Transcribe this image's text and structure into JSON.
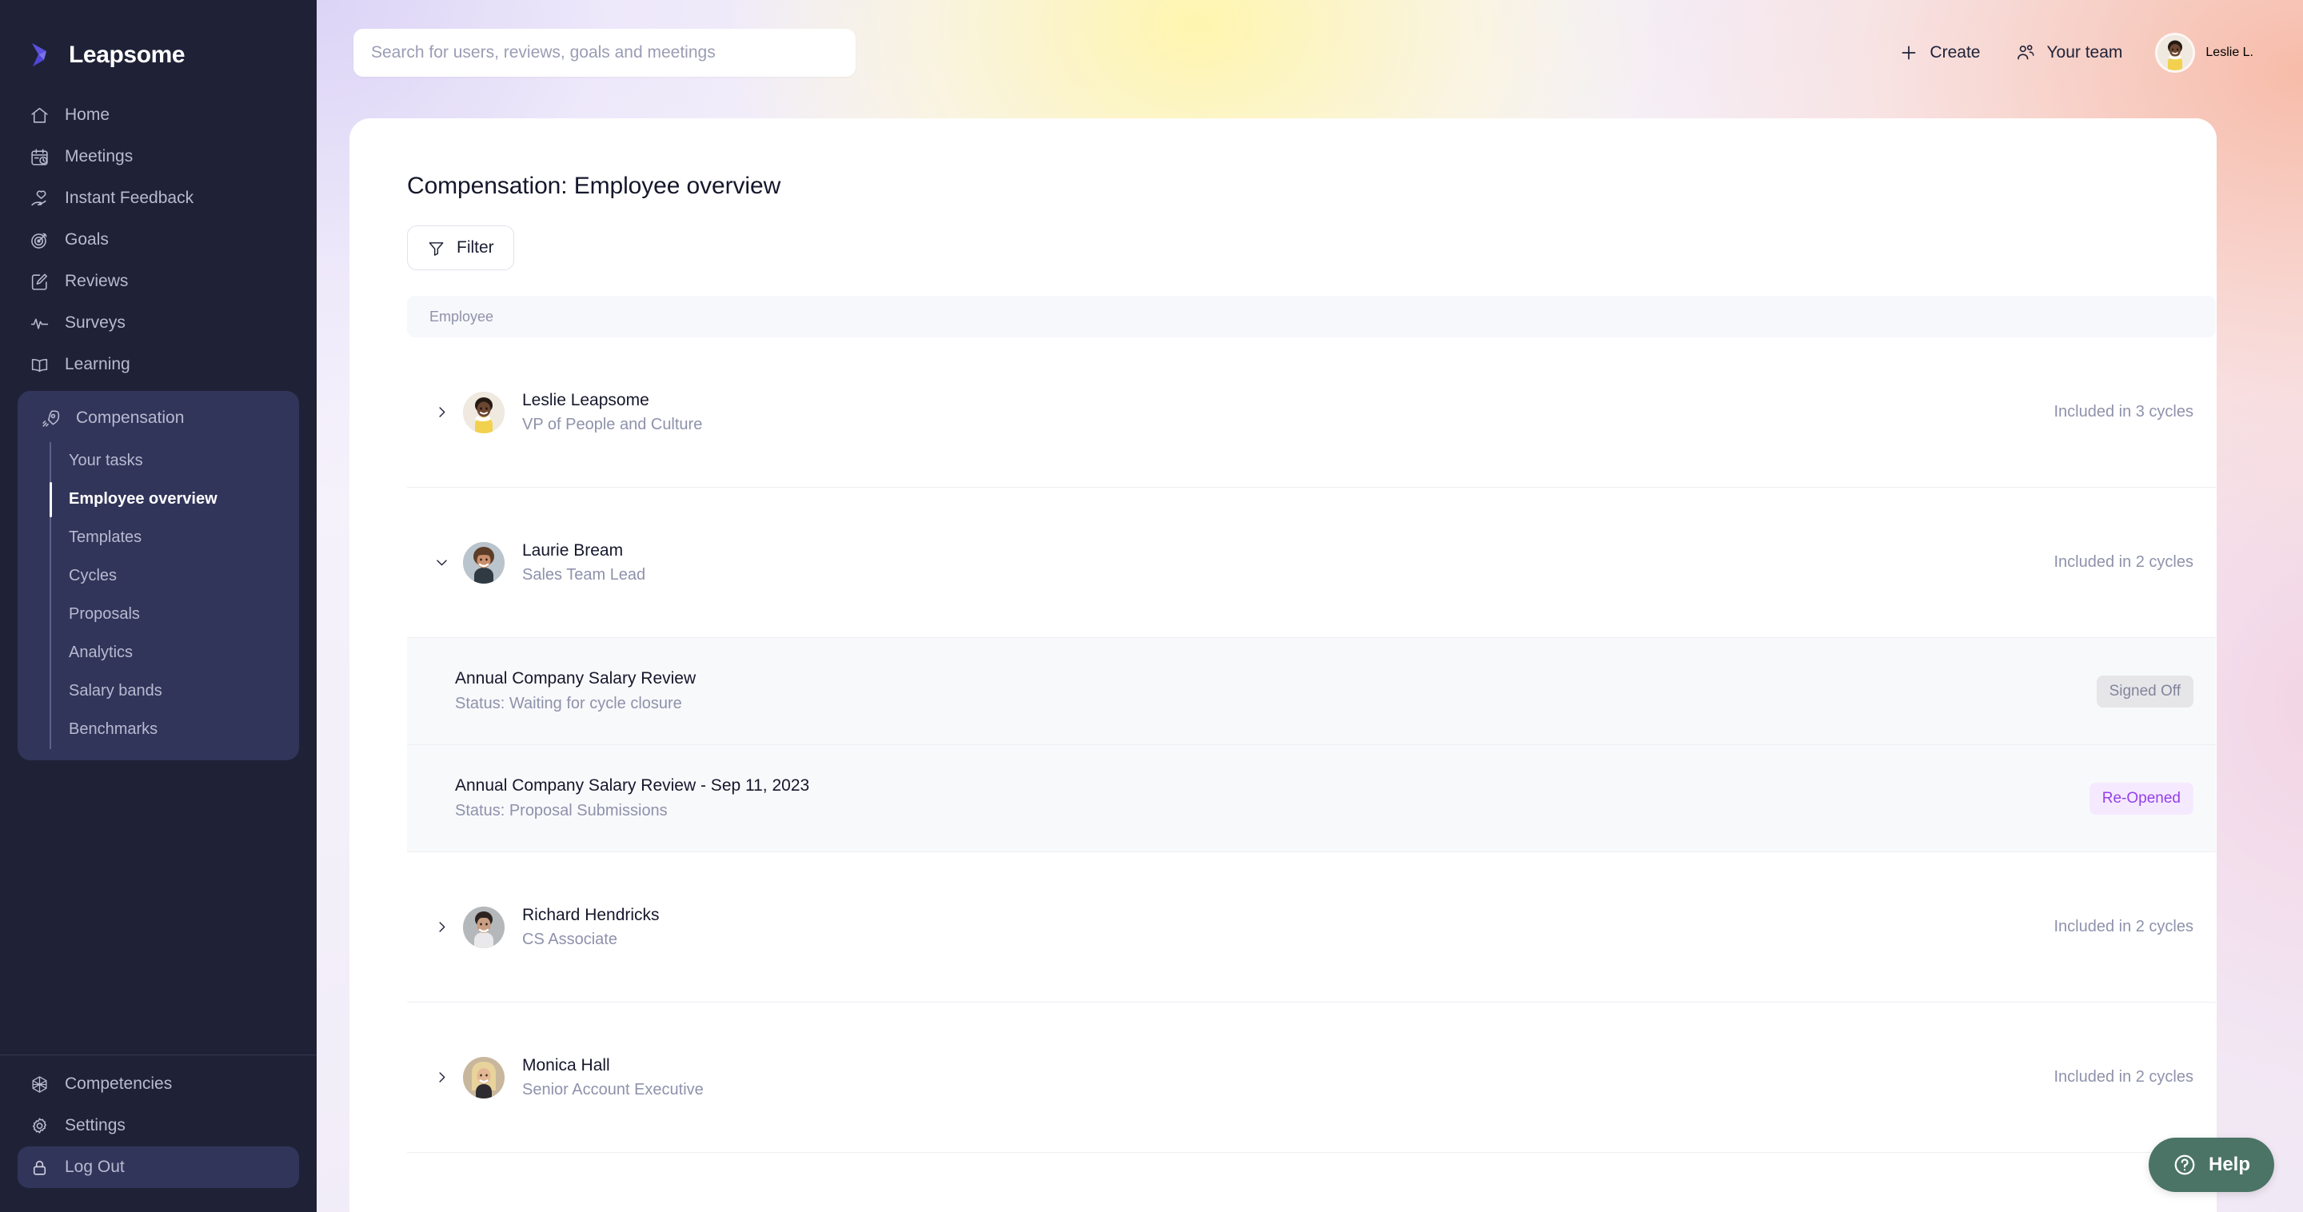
{
  "brand": {
    "name": "Leapsome"
  },
  "search": {
    "placeholder": "Search for users, reviews, goals and meetings",
    "value": ""
  },
  "topbar": {
    "create_label": "Create",
    "team_label": "Your team",
    "user_label": "Leslie L."
  },
  "sidebar": {
    "items": [
      {
        "label": "Home",
        "icon": "home-icon"
      },
      {
        "label": "Meetings",
        "icon": "calendar-clock-icon"
      },
      {
        "label": "Instant Feedback",
        "icon": "heart-hand-icon"
      },
      {
        "label": "Goals",
        "icon": "target-icon"
      },
      {
        "label": "Reviews",
        "icon": "pencil-square-icon"
      },
      {
        "label": "Surveys",
        "icon": "pulse-icon"
      },
      {
        "label": "Learning",
        "icon": "book-icon"
      }
    ],
    "group": {
      "label": "Compensation",
      "icon": "rocket-icon",
      "sub_items": [
        {
          "label": "Your tasks",
          "active": false
        },
        {
          "label": "Employee overview",
          "active": true
        },
        {
          "label": "Templates",
          "active": false
        },
        {
          "label": "Cycles",
          "active": false
        },
        {
          "label": "Proposals",
          "active": false
        },
        {
          "label": "Analytics",
          "active": false
        },
        {
          "label": "Salary bands",
          "active": false
        },
        {
          "label": "Benchmarks",
          "active": false
        }
      ]
    },
    "bottom_items": [
      {
        "label": "Competencies",
        "icon": "competency-icon"
      },
      {
        "label": "Settings",
        "icon": "gear-icon"
      },
      {
        "label": "Log Out",
        "icon": "lock-icon"
      }
    ]
  },
  "main": {
    "page_title": "Compensation: Employee overview",
    "filter_label": "Filter",
    "table": {
      "column_header": "Employee",
      "rows": [
        {
          "name": "Leslie Leapsome",
          "role": "VP of People and Culture",
          "meta": "Included in 3 cycles",
          "expanded": false,
          "avatar": "leslie",
          "cycles": []
        },
        {
          "name": "Laurie Bream",
          "role": "Sales Team Lead",
          "meta": "Included in 2 cycles",
          "expanded": true,
          "avatar": "laurie",
          "cycles": [
            {
              "title": "Annual Company Salary Review",
              "status": "Status: Waiting for cycle closure",
              "badge": "Signed Off",
              "badge_style": "grey"
            },
            {
              "title": "Annual Company Salary Review - Sep 11, 2023",
              "status": "Status: Proposal Submissions",
              "badge": "Re-Opened",
              "badge_style": "purple"
            }
          ]
        },
        {
          "name": "Richard Hendricks",
          "role": "CS Associate",
          "meta": "Included in 2 cycles",
          "expanded": false,
          "avatar": "richard",
          "cycles": []
        },
        {
          "name": "Monica Hall",
          "role": "Senior Account Executive",
          "meta": "Included in 2 cycles",
          "expanded": false,
          "avatar": "monica",
          "cycles": []
        }
      ]
    }
  },
  "help": {
    "label": "Help",
    "icon": "question-circle-icon"
  },
  "colors": {
    "sidebar_bg": "#1f2237",
    "sidebar_active": "#32355a",
    "badge_purple_bg": "#f5e9ff",
    "badge_purple_fg": "#9440e8",
    "badge_grey_bg": "#e6e6e9",
    "badge_grey_fg": "#82859b",
    "help_bg": "#4b7466"
  }
}
